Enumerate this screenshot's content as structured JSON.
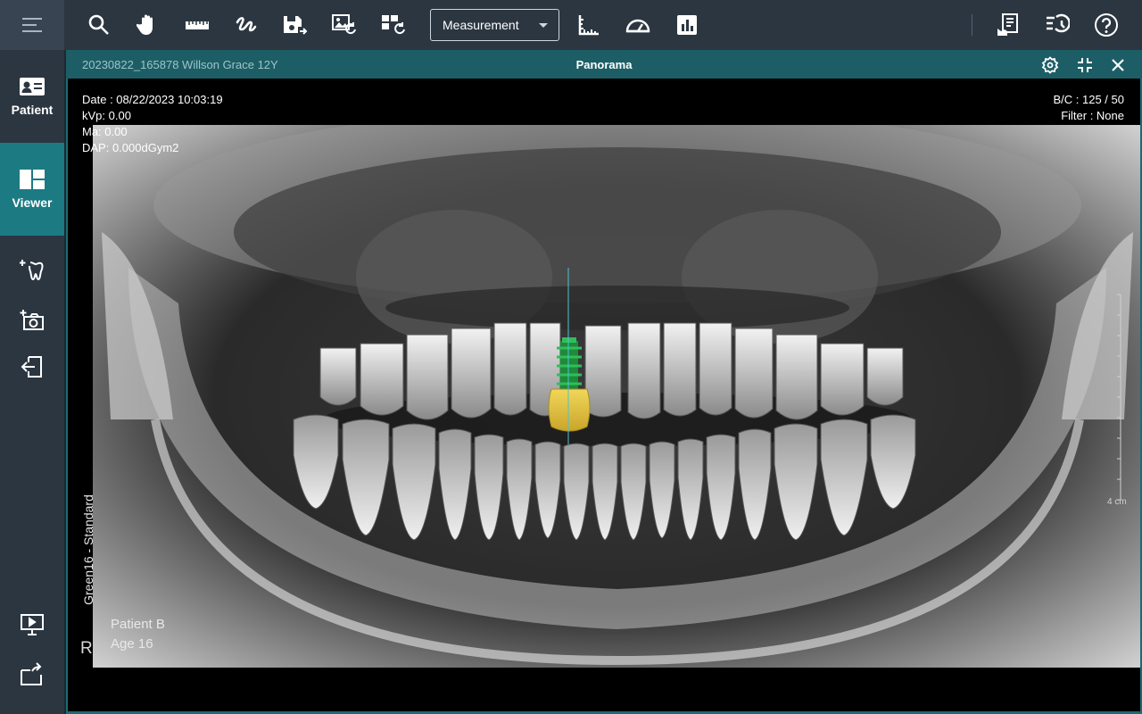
{
  "sidebar": {
    "menu_icon": "hamburger-icon",
    "nav": [
      {
        "label": "Patient",
        "icon": "patient-card-icon",
        "active": false
      },
      {
        "label": "Viewer",
        "icon": "viewer-layout-icon",
        "active": true
      }
    ],
    "tools": [
      "tooth-add-icon",
      "camera-add-icon",
      "import-icon"
    ],
    "bottom_tools": [
      "presentation-icon",
      "export-icon"
    ]
  },
  "toolbar": {
    "tools": [
      "zoom-icon",
      "pan-hand-icon",
      "ruler-icon",
      "freehand-icon",
      "save-export-icon",
      "image-refresh-icon",
      "layout-refresh-icon"
    ],
    "dropdown_value": "Measurement",
    "measure_tools": [
      "length-measure-icon",
      "angle-measure-icon",
      "histogram-icon"
    ],
    "right_tools": [
      "report-icon",
      "history-icon",
      "help-icon"
    ]
  },
  "viewer": {
    "study_label": "20230822_165878 Willson Grace 12Y",
    "title": "Panorama",
    "header_icons": [
      "settings-icon",
      "collapse-icon",
      "close-icon"
    ]
  },
  "overlay": {
    "date": "Date : 08/22/2023 10:03:19",
    "kvp": "kVp: 0.00",
    "ma": "Ma: 0.00",
    "dap": "DAP: 0.000dGym2",
    "bc": "B/C : 125 / 50",
    "filter": "Filter : None",
    "orientation": "R",
    "film_label": "Green16 - Standard",
    "patient_name": "Patient B",
    "patient_age": "Age 16",
    "scale": "4 cm"
  },
  "colors": {
    "sidebar_bg": "#2b3641",
    "accent": "#1c7a83",
    "viewer_header": "#1d5e66",
    "implant_green": "#1e8a3c",
    "crown_yellow": "#e2c23e"
  }
}
